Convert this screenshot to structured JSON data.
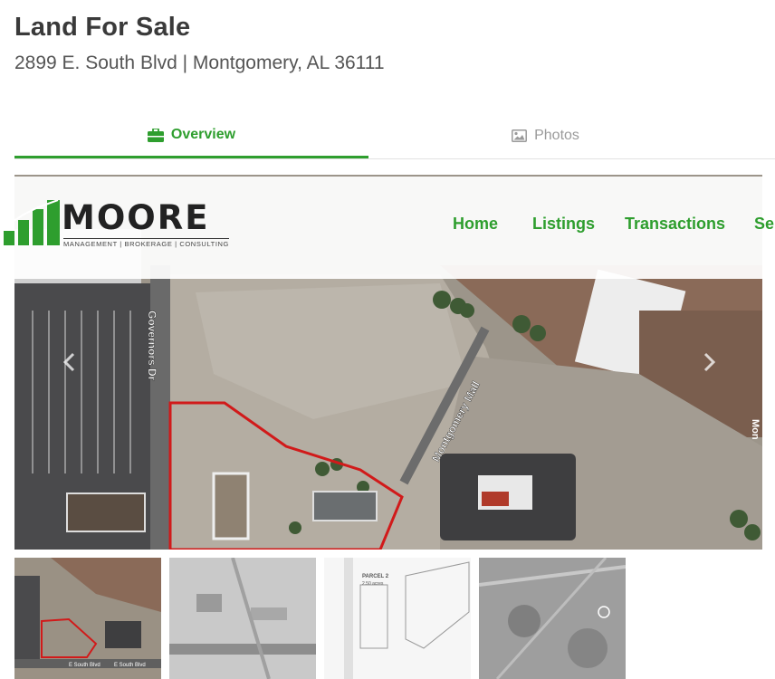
{
  "listing": {
    "title": "Land For Sale",
    "address": "2899 E. South Blvd | Montgomery, AL 36111"
  },
  "tabs": [
    {
      "label": "Overview",
      "icon": "briefcase-icon",
      "active": true
    },
    {
      "label": "Photos",
      "icon": "image-icon",
      "active": false
    }
  ],
  "navbar": {
    "logo_word": "MOORE",
    "logo_tagline": "MANAGEMENT | BROKERAGE | CONSULTING",
    "items": [
      "Home",
      "Listings",
      "Transactions",
      "Se"
    ]
  },
  "map_labels": {
    "governors": "Governors Dr",
    "mall": "Montgomery Mall",
    "edge_top": "Mont",
    "edge_right": "Mon"
  },
  "thumbnails": [
    {
      "name": "aerial-site",
      "labels": [
        "E South Blvd",
        "E South Blvd"
      ]
    },
    {
      "name": "street-aerial-bw"
    },
    {
      "name": "site-plan",
      "labels": [
        "PARCEL 2",
        "2.50 acres"
      ]
    },
    {
      "name": "area-map-bw"
    }
  ],
  "colors": {
    "accent": "#2e9e2e",
    "parcel_outline": "#d11a1a",
    "title": "#3a3a3a"
  }
}
